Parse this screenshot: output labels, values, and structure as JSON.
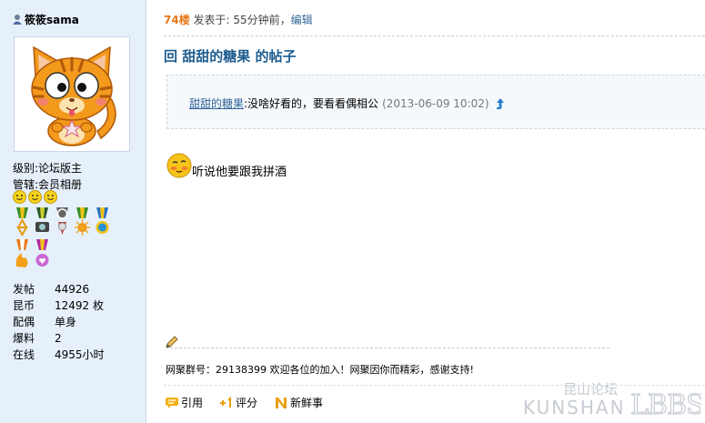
{
  "user": {
    "name": "筱筱sama",
    "level_label": "级别:",
    "level_value": "论坛版主",
    "admin_label": "管辖:",
    "admin_value": "会员相册",
    "stats": [
      {
        "key": "发帖",
        "value": "44926"
      },
      {
        "key": "昆币",
        "value": "12492 枚"
      },
      {
        "key": "配偶",
        "value": "单身"
      },
      {
        "key": "爆料",
        "value": "2"
      },
      {
        "key": "在线",
        "value": "4955小时"
      }
    ]
  },
  "post": {
    "floor": "74楼",
    "posted_text": " 发表于: 55分钟前，",
    "edit_label": "编辑",
    "title": "回 甜甜的糖果 的帖子",
    "quote": {
      "author": "甜甜的糖果",
      "body": ":没啥好看的，要看看偶相公",
      "time": "(2013-06-09 10:02)"
    },
    "message": "听说他要跟我拼酒",
    "signature": "网聚群号：29138399 欢迎各位的加入！网聚因你而精彩，感谢支持!"
  },
  "actions": {
    "quote_label": "引用",
    "rate_label": "评分",
    "fresh_label": "新鲜事"
  },
  "watermark": {
    "line1": "昆山论坛",
    "line2": "KUNSHAN",
    "logo": "LBBS"
  },
  "colors": {
    "sidebar_bg": "#e6f0fb",
    "floor_orange": "#e8771a",
    "title_blue": "#1d5c8f",
    "link_blue": "#336699"
  },
  "icons": {
    "user": "user-icon",
    "up": "up-arrow-icon",
    "pencil": "pencil-icon",
    "quote": "quote-icon",
    "rate": "plus-one-icon",
    "fresh": "fresh-icon"
  }
}
